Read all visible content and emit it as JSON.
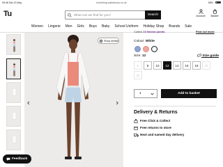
{
  "status_bar": {
    "time": "09:48",
    "date": "Sat 13 May",
    "url": "tuclothing.sainsburys.co.uk",
    "battery": "58%"
  },
  "header": {
    "logo": "Tu",
    "search_placeholder": "What can we find for you?",
    "search_button": "Search",
    "account_label": "Account",
    "basket_label": "Basket"
  },
  "nav": [
    "Women",
    "Lingerie",
    "Men",
    "Girls",
    "Boys",
    "Baby",
    "School Uniform",
    "Holiday Shop",
    "Brands",
    "Sale"
  ],
  "product": {
    "nectar_text": "Collect",
    "nectar_points": "10 Nectar points",
    "find_out_more": "Find out more",
    "colour_label": "Colour:",
    "colour_value": "White",
    "size_label": "Size:",
    "size_value": "12",
    "size_guide": "Size guide",
    "sizes": [
      "6",
      "8",
      "10",
      "12",
      "14",
      "16",
      "18",
      "20",
      "22"
    ],
    "quantity": "1",
    "add_to_basket": "Add to basket",
    "shop_similar": "Shop similar"
  },
  "delivery": {
    "title": "Delivery & Returns",
    "options": [
      "Free Click & Collect",
      "Free returns to store",
      "Next and named day delivery"
    ]
  },
  "feedback_label": "Feedback",
  "colors": {
    "accent": "#111111",
    "nectar": "#6c2d8c",
    "image_bg": "#ecebe9"
  }
}
